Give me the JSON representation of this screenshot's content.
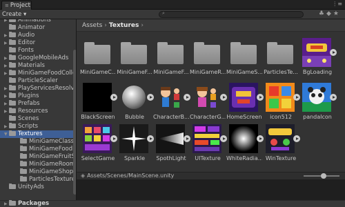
{
  "window": {
    "tab_label": "Project",
    "tab_icon": "list-icon",
    "menu_icon": "window-menu-icon"
  },
  "toolbar": {
    "create_label": "Create ▾",
    "search_placeholder": "",
    "search_icon": "magnifier-icon",
    "icons": [
      "filter-icon",
      "label-icon",
      "favorite-star-icon"
    ]
  },
  "tree": {
    "items": [
      {
        "label": "Animations",
        "depth": 1,
        "arrow": "▶",
        "selected": false
      },
      {
        "label": "Animator",
        "depth": 1,
        "arrow": "",
        "selected": false
      },
      {
        "label": "Audio",
        "depth": 1,
        "arrow": "▶",
        "selected": false
      },
      {
        "label": "Editor",
        "depth": 1,
        "arrow": "▶",
        "selected": false
      },
      {
        "label": "Fonts",
        "depth": 1,
        "arrow": "",
        "selected": false
      },
      {
        "label": "GoogleMobileAds",
        "depth": 1,
        "arrow": "▶",
        "selected": false
      },
      {
        "label": "Materials",
        "depth": 1,
        "arrow": "▶",
        "selected": false
      },
      {
        "label": "MiniGameFoodColle",
        "depth": 1,
        "arrow": "▶",
        "selected": false
      },
      {
        "label": "ParticleScaler",
        "depth": 1,
        "arrow": "",
        "selected": false
      },
      {
        "label": "PlayServicesResolv",
        "depth": 1,
        "arrow": "▶",
        "selected": false
      },
      {
        "label": "Plugins",
        "depth": 1,
        "arrow": "▶",
        "selected": false
      },
      {
        "label": "Prefabs",
        "depth": 1,
        "arrow": "▶",
        "selected": false
      },
      {
        "label": "Resources",
        "depth": 1,
        "arrow": "▶",
        "selected": false
      },
      {
        "label": "Scenes",
        "depth": 1,
        "arrow": "",
        "selected": false
      },
      {
        "label": "Scripts",
        "depth": 1,
        "arrow": "▶",
        "selected": false
      },
      {
        "label": "Textures",
        "depth": 1,
        "arrow": "▼",
        "selected": true
      },
      {
        "label": "MiniGameClassifi",
        "depth": 2,
        "arrow": "",
        "selected": false
      },
      {
        "label": "MiniGameFoodMa",
        "depth": 2,
        "arrow": "",
        "selected": false
      },
      {
        "label": "MiniGameFruitSli",
        "depth": 2,
        "arrow": "",
        "selected": false
      },
      {
        "label": "MiniGameRoomC",
        "depth": 2,
        "arrow": "",
        "selected": false
      },
      {
        "label": "MiniGameShoppi",
        "depth": 2,
        "arrow": "",
        "selected": false
      },
      {
        "label": "ParticlesTextures",
        "depth": 2,
        "arrow": "",
        "selected": false
      },
      {
        "label": "UnityAds",
        "depth": 1,
        "arrow": "",
        "selected": false
      }
    ],
    "packages_label": "Packages",
    "packages_arrow": "▶"
  },
  "breadcrumb": {
    "parts": [
      "Assets",
      "Textures"
    ],
    "separator": "›",
    "trailing": "›"
  },
  "assets": [
    {
      "label": "MiniGameC...",
      "kind": "folder",
      "icon": "folder-icon"
    },
    {
      "label": "MiniGameF...",
      "kind": "folder",
      "icon": "folder-icon"
    },
    {
      "label": "MiniGameF...",
      "kind": "folder",
      "icon": "folder-icon"
    },
    {
      "label": "MiniGameR...",
      "kind": "folder",
      "icon": "folder-icon"
    },
    {
      "label": "MiniGameS...",
      "kind": "folder",
      "icon": "folder-icon"
    },
    {
      "label": "ParticlesTe...",
      "kind": "folder",
      "icon": "folder-icon"
    },
    {
      "label": "BgLoading",
      "kind": "texture",
      "icon": "bg-loading-thumbnail"
    },
    {
      "label": "BlackScreen",
      "kind": "texture",
      "icon": "black-screen-thumbnail"
    },
    {
      "label": "Bubble",
      "kind": "texture",
      "icon": "bubble-thumbnail"
    },
    {
      "label": "CharacterB...",
      "kind": "texture",
      "icon": "character-boy-thumbnail"
    },
    {
      "label": "CharacterG...",
      "kind": "texture",
      "icon": "character-girl-thumbnail"
    },
    {
      "label": "HomeScreen",
      "kind": "texture",
      "icon": "home-screen-thumbnail"
    },
    {
      "label": "icon512",
      "kind": "texture",
      "icon": "app-icon-thumbnail"
    },
    {
      "label": "pandaIcon",
      "kind": "texture",
      "icon": "panda-icon-thumbnail"
    },
    {
      "label": "SelectGame",
      "kind": "texture",
      "icon": "select-game-thumbnail"
    },
    {
      "label": "Sparkle",
      "kind": "texture",
      "icon": "sparkle-thumbnail"
    },
    {
      "label": "SpothLight",
      "kind": "texture",
      "icon": "spotlight-thumbnail"
    },
    {
      "label": "UITexture",
      "kind": "texture",
      "icon": "ui-texture-thumbnail"
    },
    {
      "label": "WhiteRadia...",
      "kind": "texture",
      "icon": "white-radial-thumbnail"
    },
    {
      "label": "WinTexture",
      "kind": "texture",
      "icon": "win-texture-thumbnail"
    }
  ],
  "status": {
    "path": "Assets/Scenes/MainScene.unity",
    "icon": "unity-scene-icon",
    "zoom_fraction": 0.45
  },
  "colors": {
    "selection": "#3e5f96",
    "panel": "#383838",
    "grid_bg": "#333333"
  }
}
